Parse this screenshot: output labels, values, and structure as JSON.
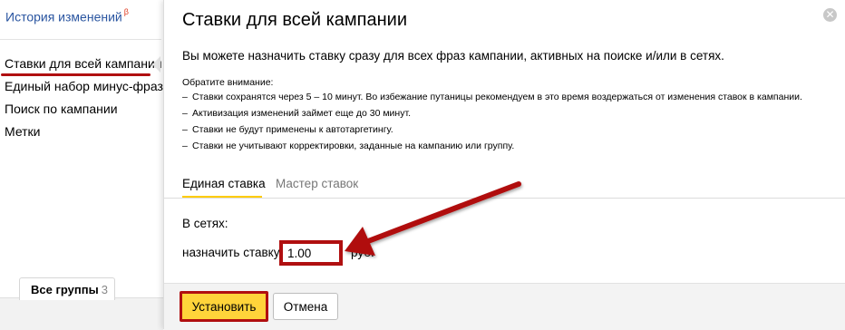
{
  "sidebar": {
    "history_label": "История изменений",
    "history_badge": "β",
    "items": [
      {
        "label": "Ставки для всей кампании"
      },
      {
        "label": "Единый набор минус-фраз"
      },
      {
        "label": "Поиск по кампании"
      },
      {
        "label": "Метки"
      }
    ]
  },
  "groups_tab": {
    "label": "Все группы",
    "count": "3"
  },
  "modal": {
    "title": "Ставки для всей кампании",
    "description": "Вы можете назначить ставку сразу для всех фраз кампании, активных на поиске и/или в сетях.",
    "note_heading": "Обратите внимание:",
    "notes": [
      "Ставки сохранятся через 5 – 10 минут. Во избежание путаницы рекомендуем в это время воздержаться от изменения ставок в кампании.",
      "Активизация изменений займет еще до 30 минут.",
      "Ставки не будут применены к автотаргетингу.",
      "Ставки не учитывают корректировки, заданные на кампанию или группу."
    ],
    "tabs": [
      {
        "label": "Единая ставка",
        "active": true
      },
      {
        "label": "Мастер ставок",
        "active": false
      }
    ],
    "networks_label": "В сетях:",
    "assign_label": "назначить ставку",
    "bid_value": "1.00",
    "currency_label": "руб.",
    "set_button": "Установить",
    "cancel_button": "Отмена"
  },
  "colors": {
    "highlight_red": "#b00f10",
    "accent_yellow": "#ffd43a",
    "link_blue": "#2a55a0"
  },
  "icons": {
    "close": "close-circle-icon"
  }
}
